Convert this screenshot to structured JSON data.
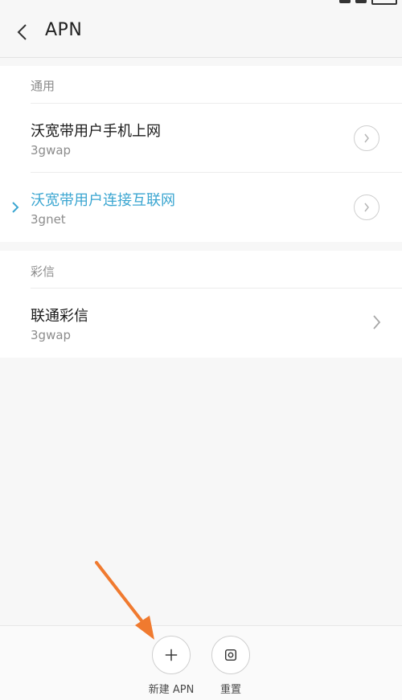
{
  "header": {
    "title": "APN"
  },
  "sections": {
    "general": {
      "label": "通用",
      "items": [
        {
          "name": "沃宽带用户手机上网",
          "sub": "3gwap",
          "active": false
        },
        {
          "name": "沃宽带用户连接互联网",
          "sub": "3gnet",
          "active": true
        }
      ]
    },
    "mms": {
      "label": "彩信",
      "items": [
        {
          "name": "联通彩信",
          "sub": "3gwap"
        }
      ]
    }
  },
  "bottom_bar": {
    "new_apn_label": "新建 APN",
    "reset_label": "重置"
  },
  "colors": {
    "active": "#3ba6d1",
    "annotation_arrow": "#f07a2f",
    "background": "#f7f7f7"
  },
  "icons": {
    "back": "chevron-left-icon",
    "row_detail": "circle-chevron-right-icon",
    "row_plain": "chevron-right-icon",
    "new": "plus-icon",
    "reset": "reset-square-icon"
  }
}
